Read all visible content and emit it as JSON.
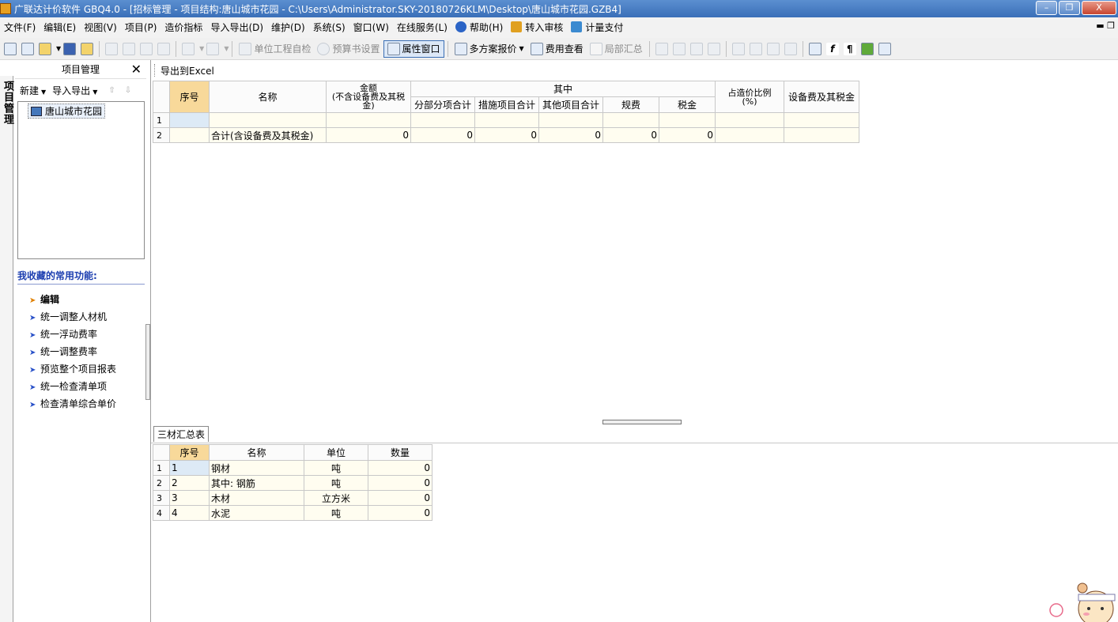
{
  "window": {
    "title": "广联达计价软件 GBQ4.0 - [招标管理 - 项目结构:唐山城市花园 - C:\\Users\\Administrator.SKY-20180726KLM\\Desktop\\唐山城市花园.GZB4]",
    "minimize": "–",
    "restore": "❐",
    "close": "X"
  },
  "menu": {
    "items": [
      "文件(F)",
      "编辑(E)",
      "视图(V)",
      "项目(P)",
      "造价指标",
      "导入导出(D)",
      "维护(D)",
      "系统(S)",
      "窗口(W)",
      "在线服务(L)"
    ],
    "help": "帮助(H)",
    "transfer_review": "转入审核",
    "measure_pay": "计量支付"
  },
  "toolbar": {
    "unit_check": "单位工程自检",
    "budget_settings": "预算书设置",
    "property_window": "属性窗口",
    "multi_quote": "多方案报价",
    "cost_view": "费用查看",
    "partial_sum": "局部汇总"
  },
  "left_tab": {
    "label": "项目管理"
  },
  "left_panel": {
    "title": "项目管理",
    "close": "✕",
    "new_label": "新建",
    "import_export_label": "导入导出",
    "tree_root": "唐山城市花园",
    "fav_title": "我收藏的常用功能:",
    "fav_items": [
      "编辑",
      "统一调整人材机",
      "统一浮动费率",
      "统一调整费率",
      "预览整个项目报表",
      "统一检查清单项",
      "检查清单综合单价"
    ]
  },
  "main": {
    "export_excel": "导出到Excel",
    "headers": {
      "seq": "序号",
      "name": "名称",
      "amount": "金额\n(不含设备费及其税金)",
      "of_which": "其中",
      "sub_items": "分部分项合计",
      "measures": "措施项目合计",
      "others": "其他项目合计",
      "fees": "规费",
      "tax": "税金",
      "ratio": "占造价比例\n(%)",
      "equipment": "设备费及其税金"
    },
    "rows": [
      {
        "rh": "1",
        "seq": "",
        "name": "",
        "amount": "",
        "sub": "",
        "meas": "",
        "oth": "",
        "fee": "",
        "tax": "",
        "ratio": "",
        "equip": ""
      },
      {
        "rh": "2",
        "seq": "",
        "name": "合计(含设备费及其税金)",
        "amount": "0",
        "sub": "0",
        "meas": "0",
        "oth": "0",
        "fee": "0",
        "tax": "0",
        "ratio": "",
        "equip": ""
      }
    ]
  },
  "bottom": {
    "tab": "三材汇总表",
    "headers": {
      "seq": "序号",
      "name": "名称",
      "unit": "单位",
      "qty": "数量"
    },
    "rows": [
      {
        "rh": "1",
        "seq": "1",
        "name": "钢材",
        "unit": "吨",
        "qty": "0"
      },
      {
        "rh": "2",
        "seq": "2",
        "name": "其中: 钢筋",
        "unit": "吨",
        "qty": "0"
      },
      {
        "rh": "3",
        "seq": "3",
        "name": "木材",
        "unit": "立方米",
        "qty": "0"
      },
      {
        "rh": "4",
        "seq": "4",
        "name": "水泥",
        "unit": "吨",
        "qty": "0"
      }
    ]
  },
  "colors": {
    "title_bar": "#3a6fb8",
    "header_seq": "#f8d99a",
    "cell_bg": "#fffdf0",
    "fav_title": "#1c3eb0"
  }
}
